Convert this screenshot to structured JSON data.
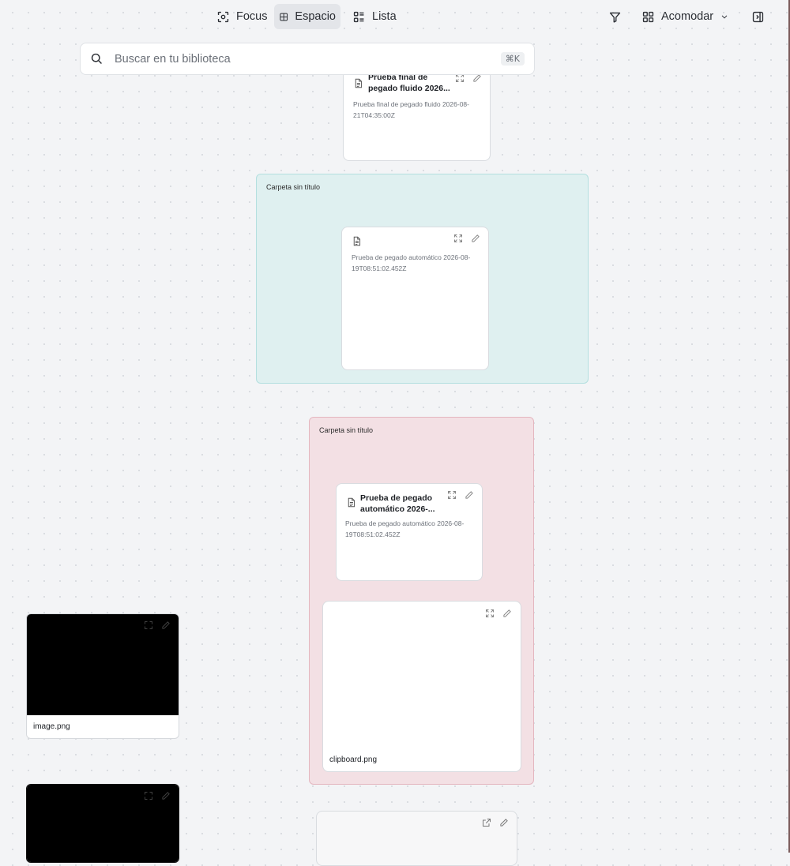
{
  "toolbar": {
    "views": [
      {
        "label": "Focus",
        "icon": "focus-icon"
      },
      {
        "label": "Espacio",
        "icon": "grid-icon",
        "active": true
      },
      {
        "label": "Lista",
        "icon": "list-icon"
      }
    ],
    "filter_icon": "filter-icon",
    "arrange_label": "Acomodar",
    "panel_icon": "panel-toggle-icon"
  },
  "search": {
    "placeholder": "Buscar en tu biblioteca",
    "shortcut": "⌘K"
  },
  "folders": [
    {
      "title": "Carpeta sin título",
      "color": "#dff0f0"
    },
    {
      "title": "Carpeta sin título",
      "color": "#f3e0e4"
    }
  ],
  "cards": {
    "top": {
      "title_line1": "Prueba final de",
      "title_line2": "pegado fluido 2026...",
      "body_line1": "Prueba final de pegado fluido 2026-08-",
      "body_line2": "21T04:35:00Z"
    },
    "teal_note": {
      "body_line1": "Prueba de pegado automático 2026-08-",
      "body_line2": "19T08:51:02.452Z"
    },
    "pink_note": {
      "title_line1": "Prueba de pegado",
      "title_line2": "automático 2026-...",
      "body_line1": "Prueba de pegado automático 2026-08-",
      "body_line2": "19T08:51:02.452Z"
    },
    "clipboard": {
      "filename": "clipboard.png"
    },
    "image1": {
      "filename": "image.png"
    }
  }
}
